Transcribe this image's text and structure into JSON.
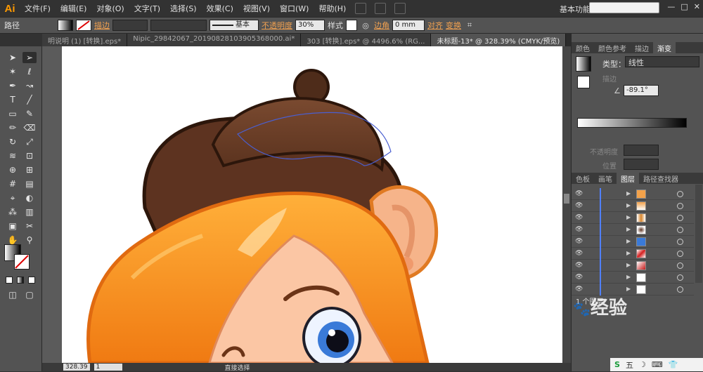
{
  "app": {
    "logo": "Ai"
  },
  "menu": [
    "文件(F)",
    "编辑(E)",
    "对象(O)",
    "文字(T)",
    "选择(S)",
    "效果(C)",
    "视图(V)",
    "窗口(W)",
    "帮助(H)"
  ],
  "workspace": "基本功能",
  "window_buttons": [
    "—",
    "□",
    "✕"
  ],
  "control": {
    "object_type": "路径",
    "stroke_label": "描边",
    "brush": "基本",
    "opacity_label": "不透明度",
    "opacity_value": "30%",
    "style_label": "样式",
    "corner_label": "边角",
    "corner_value": "0 mm",
    "align": "对齐",
    "transform": "变换"
  },
  "tabs": [
    {
      "label": "明说明 (1) [转换].eps*",
      "active": false
    },
    {
      "label": "Nipic_29842067_20190828103905368000.ai*",
      "active": false
    },
    {
      "label": "303 [转换].eps* @ 4496.6% (RG...",
      "active": false
    },
    {
      "label": "未标题-13* @ 328.39% (CMYK/预览)",
      "active": true
    }
  ],
  "status": {
    "zoom": "328.39",
    "page": "1",
    "tool_name": "直接选择"
  },
  "gradient_panel": {
    "tabs": [
      "颜色",
      "颜色参考",
      "描边",
      "渐变"
    ],
    "type_label": "类型：",
    "type_value": "线性",
    "stroke_label": "描边",
    "angle": "-89.1°",
    "opacity_label": "不透明度",
    "position_label": "位置"
  },
  "layers_panel": {
    "tabs": [
      "色板",
      "画笔",
      "图层",
      "路径查找器"
    ],
    "footer": "1 个图层"
  },
  "watermark": "经验",
  "taskbar": [
    "五",
    "☽",
    "⌨",
    "👕"
  ],
  "colors": {
    "accent_orange": "#f0a050",
    "logo": "#ff9a00",
    "selection_blue": "#4a5fd0"
  }
}
